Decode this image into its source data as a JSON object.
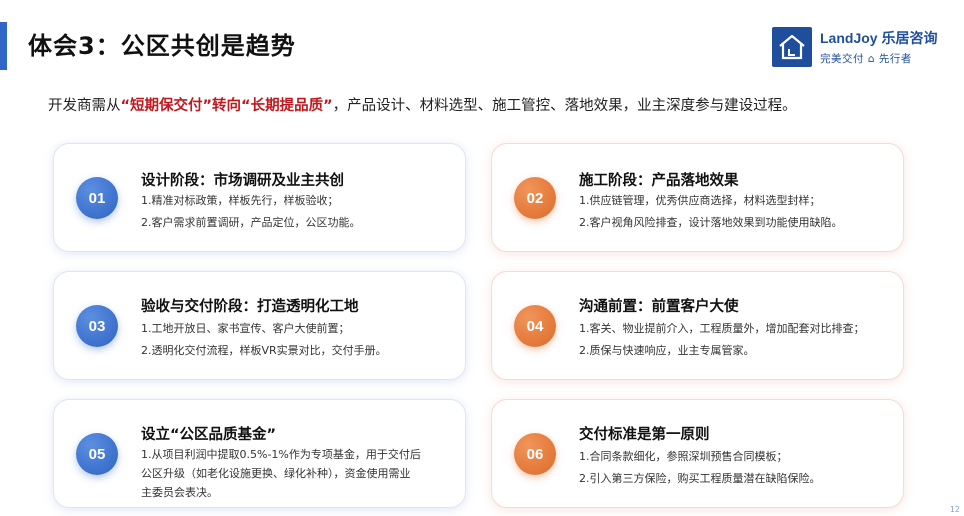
{
  "header": {
    "title": "体会3：公区共创是趋势",
    "logo_brand": "LandJoy 乐居咨询",
    "logo_slogan": "完美交付 ⌂ 先行者"
  },
  "intro": {
    "prefix": "开发商需从",
    "highlight": "“短期保交付”转向“长期提品质”",
    "suffix": "，产品设计、材料选型、施工管控、落地效果，业主深度参与建设过程。"
  },
  "cards": [
    {
      "number": "01",
      "color": "#2f63c4",
      "title": "设计阶段：市场调研及业主共创",
      "lines": [
        "1.精准对标政策，样板先行，样板验收；",
        "2.客户需求前置调研，产品定位，公区功能。"
      ]
    },
    {
      "number": "02",
      "color": "#de6a28",
      "title": "施工阶段：产品落地效果",
      "lines": [
        "1.供应链管理，优秀供应商选择，材料选型封样；",
        "2.客户视角风险排查，设计落地效果到功能使用缺陷。"
      ]
    },
    {
      "number": "03",
      "color": "#2f63c4",
      "title": "验收与交付阶段：打造透明化工地",
      "lines": [
        "1.工地开放日、家书宣传、客户大使前置；",
        "2.透明化交付流程，样板VR实景对比，交付手册。"
      ]
    },
    {
      "number": "04",
      "color": "#de6a28",
      "title": "沟通前置：前置客户大使",
      "lines": [
        "1.客关、物业提前介入，工程质量外，增加配套对比排查；",
        "2.质保与快速响应，业主专属管家。"
      ]
    },
    {
      "number": "05",
      "color": "#2f63c4",
      "title": "设立“公区品质基金”",
      "lines": [
        "1.从项目利润中提取0.5%-1%作为专项基金，用于交付后",
        "公区升级（如老化设施更换、绿化补种），资金使用需业",
        "主委员会表决。"
      ]
    },
    {
      "number": "06",
      "color": "#de6a28",
      "title": "交付标准是第一原则",
      "lines": [
        "1.合同条款细化，参照深圳预售合同模板；",
        "2.引入第三方保险，购买工程质量潜在缺陷保险。"
      ]
    }
  ],
  "page_number": "12"
}
